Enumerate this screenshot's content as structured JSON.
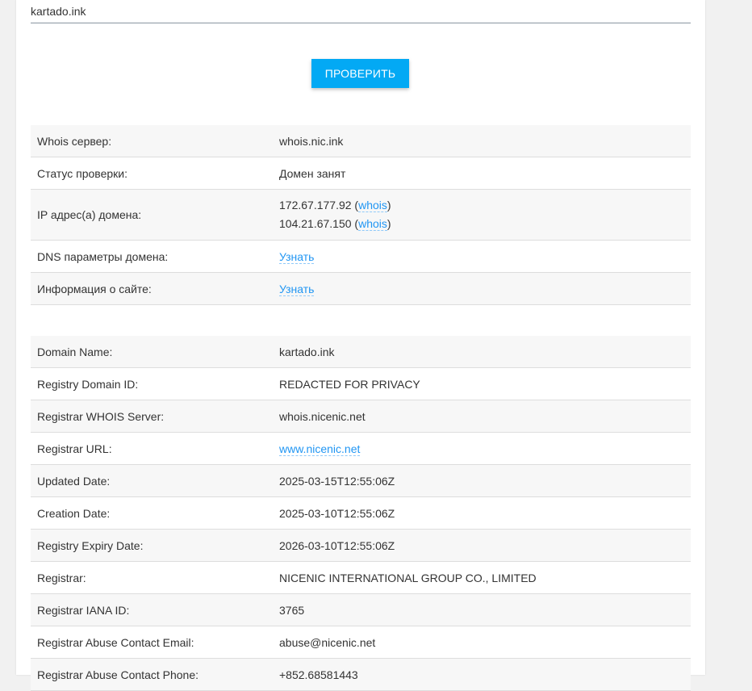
{
  "search": {
    "domain_value": "kartado.ink"
  },
  "check_button": {
    "label": "ПРОВЕРИТЬ"
  },
  "summary": {
    "whois_server": {
      "label": "Whois сервер:",
      "value": "whois.nic.ink"
    },
    "status": {
      "label": "Статус проверки:",
      "value": "Домен занят"
    },
    "ip": {
      "label": "IP адрес(а) домена:",
      "addresses": [
        {
          "ip": "172.67.177.92",
          "open": "(",
          "link": "whois",
          "close": ")"
        },
        {
          "ip": "104.21.67.150",
          "open": "(",
          "link": "whois",
          "close": ")"
        }
      ]
    },
    "dns": {
      "label": "DNS параметры домена:",
      "link": "Узнать"
    },
    "site_info": {
      "label": "Информация о сайте:",
      "link": "Узнать"
    }
  },
  "whois": {
    "rows": [
      {
        "label": "Domain Name:",
        "value": "kartado.ink"
      },
      {
        "label": "Registry Domain ID:",
        "value": "REDACTED FOR PRIVACY"
      },
      {
        "label": "Registrar WHOIS Server:",
        "value": "whois.nicenic.net"
      },
      {
        "label": "Registrar URL:",
        "value": "www.nicenic.net"
      },
      {
        "label": "Updated Date:",
        "value": "2025-03-15T12:55:06Z"
      },
      {
        "label": "Creation Date:",
        "value": "2025-03-10T12:55:06Z"
      },
      {
        "label": "Registry Expiry Date:",
        "value": "2026-03-10T12:55:06Z"
      },
      {
        "label": "Registrar:",
        "value": "NICENIC INTERNATIONAL GROUP CO., LIMITED"
      },
      {
        "label": "Registrar IANA ID:",
        "value": "3765"
      },
      {
        "label": "Registrar Abuse Contact Email:",
        "value": "abuse@nicenic.net"
      },
      {
        "label": "Registrar Abuse Contact Phone:",
        "value": "+852.68581443"
      }
    ]
  },
  "colors": {
    "accent": "#03a9f4",
    "link": "#2196f3",
    "row_alt": "#f7f7f7"
  }
}
